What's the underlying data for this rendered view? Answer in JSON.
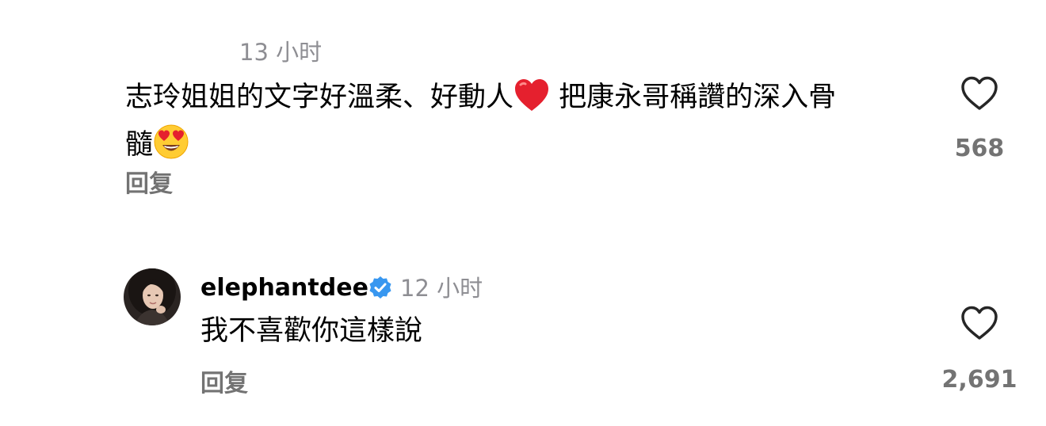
{
  "comments": [
    {
      "time": "13 小时",
      "text_part1": "志玲姐姐的文字好溫柔、好動人",
      "text_part2": "把康永哥稱讚的深入骨",
      "text_part3": "髓",
      "emoji_1": "red-heart",
      "emoji_2": "heart-eyes-face",
      "reply_label": "回复",
      "like_count": "568"
    },
    {
      "username": "elephantdee",
      "verified": true,
      "time": "12 小时",
      "text": "我不喜歡你這樣說",
      "reply_label": "回复",
      "like_count": "2,691"
    }
  ],
  "colors": {
    "verified_badge": "#3897f0",
    "muted_text": "#737373",
    "heart_emoji": "#e5202e"
  }
}
